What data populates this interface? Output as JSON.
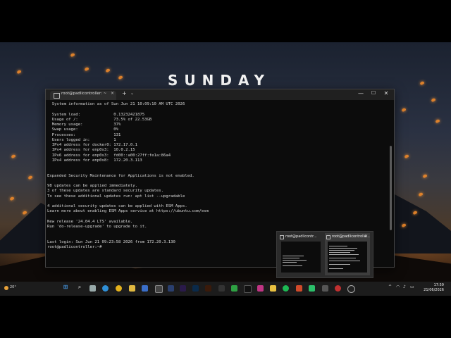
{
  "wallpaper": {
    "title": "SUNDAY"
  },
  "terminal": {
    "tab_label": "root@padlicontroller: ~",
    "tab_close": "×",
    "new_tab": "+",
    "dropdown": "⌄",
    "min": "—",
    "max": "☐",
    "close": "✕",
    "lines": [
      "  System information as of Sun Jun 21 10:09:10 AM UTC 2026",
      "",
      "  System load:              0.13232421875",
      "  Usage of /:               73.5% of 22.53GB",
      "  Memory usage:             37%",
      "  Swap usage:               0%",
      "  Processes:                131",
      "  Users logged in:          1",
      "  IPv4 address for docker0: 172.17.0.1",
      "  IPv4 address for enp0s3:  10.0.2.15",
      "  IPv6 address for enp0s3:  fd00::a00:27ff:fe1a:86a4",
      "  IPv4 address for enp0s8:  172.20.3.113",
      "",
      "",
      "Expanded Security Maintenance for Applications is not enabled.",
      "",
      "98 updates can be applied immediately.",
      "3 of these updates are standard security updates.",
      "To see these additional updates run: apt list --upgradable",
      "",
      "4 additional security updates can be applied with ESM Apps.",
      "Learn more about enabling ESM Apps service at https://ubuntu.com/esm",
      "",
      "New release '24.04.4 LTS' available.",
      "Run 'do-release-upgrade' to upgrade to it.",
      "",
      "",
      "Last login: Sun Jun 21 09:23:58 2026 from 172.20.3.130",
      "root@padlicontroller:~#"
    ]
  },
  "preview": {
    "items": [
      {
        "title": "root@padlicontr..."
      },
      {
        "title": "root@padlicontrolle..."
      }
    ],
    "close": "✕"
  },
  "taskbar": {
    "weather_temp": "20°",
    "time": "17:59",
    "date": "21/06/2026",
    "lang": "^",
    "tray_wifi": "◠",
    "tray_volume": "♪",
    "tray_battery": "▭"
  }
}
